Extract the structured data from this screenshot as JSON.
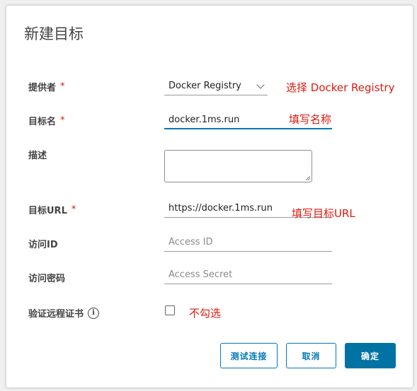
{
  "dialog": {
    "title": "新建目标"
  },
  "form": {
    "provider": {
      "label": "提供者",
      "required": "*",
      "value": "Docker Registry"
    },
    "target_name": {
      "label": "目标名",
      "required": "*",
      "value": "docker.1ms.run"
    },
    "description": {
      "label": "描述",
      "value": ""
    },
    "target_url": {
      "label": "目标URL",
      "required": "*",
      "value": "https://docker.1ms.run"
    },
    "access_id": {
      "label": "访问ID",
      "placeholder": "Access ID"
    },
    "access_secret": {
      "label": "访问密码",
      "placeholder": "Access Secret"
    },
    "verify_cert": {
      "label": "验证远程证书",
      "checked": false,
      "info_icon": "info-icon"
    }
  },
  "annotations": {
    "provider": "选择 Docker Registry",
    "target_name": "填写名称",
    "target_url": "填写目标URL",
    "verify_cert": "不勾选",
    "color": "#e0190f"
  },
  "buttons": {
    "test": "测试连接",
    "cancel": "取消",
    "ok": "确定"
  },
  "colors": {
    "primary": "#0072a3",
    "active_underline": "#0079b8",
    "required": "#c92100"
  }
}
